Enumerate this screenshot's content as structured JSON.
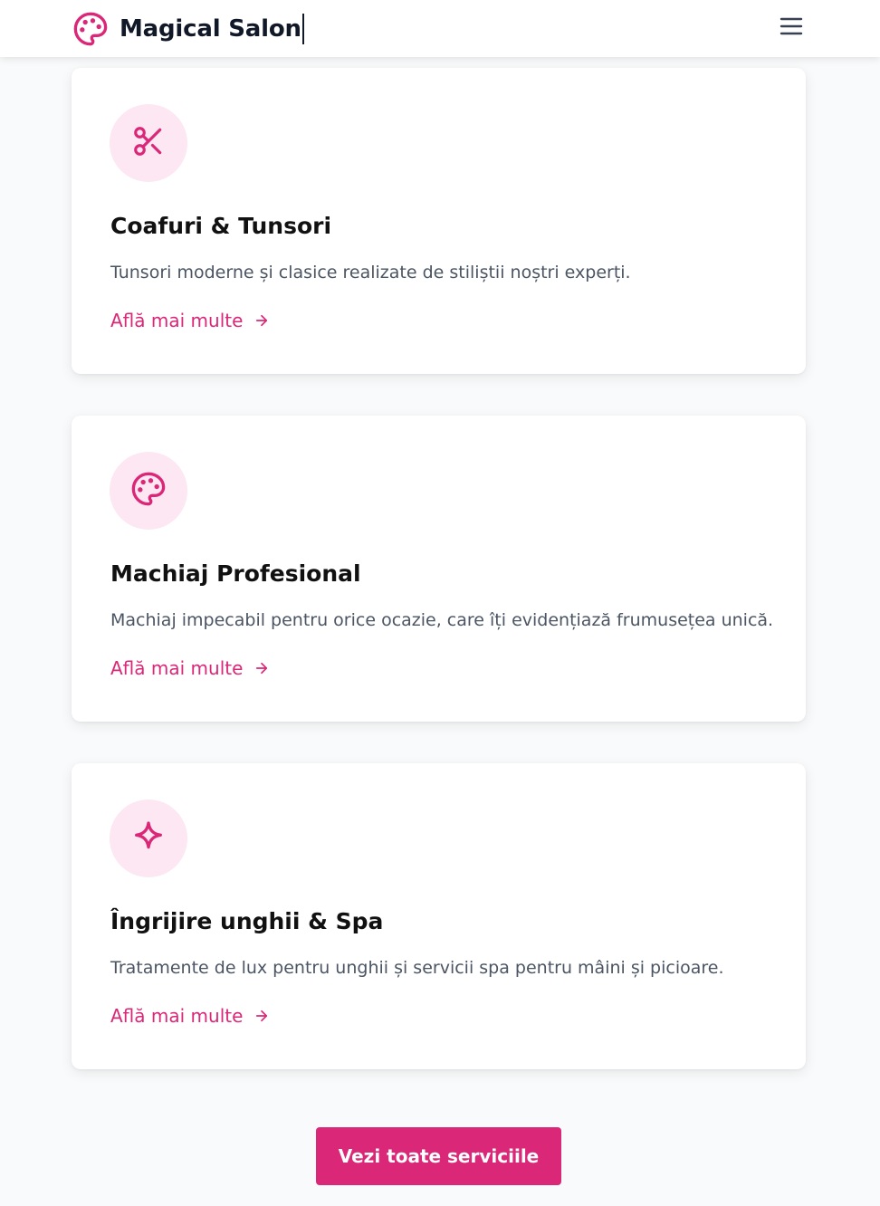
{
  "header": {
    "brand_name": "Magical Salon",
    "brand_icon": "palette-icon",
    "menu_icon": "hamburger-menu-icon"
  },
  "services": [
    {
      "icon": "scissors-icon",
      "title": "Coafuri & Tunsori",
      "description": "Tunsori moderne și clasice realizate de stiliștii noștri experți.",
      "link_label": "Află mai multe"
    },
    {
      "icon": "palette-icon",
      "title": "Machiaj Profesional",
      "description": "Machiaj impecabil pentru orice ocazie, care îți evidențiază frumusețea unică.",
      "link_label": "Află mai multe"
    },
    {
      "icon": "sparkle-icon",
      "title": "Îngrijire unghii & Spa",
      "description": "Tratamente de lux pentru unghii și servicii spa pentru mâini și picioare.",
      "link_label": "Află mai multe"
    }
  ],
  "cta": {
    "label": "Vezi toate serviciile"
  },
  "colors": {
    "accent": "#db2777",
    "icon_bg": "#fce7f3",
    "text": "#111827",
    "muted": "#4b5563"
  }
}
